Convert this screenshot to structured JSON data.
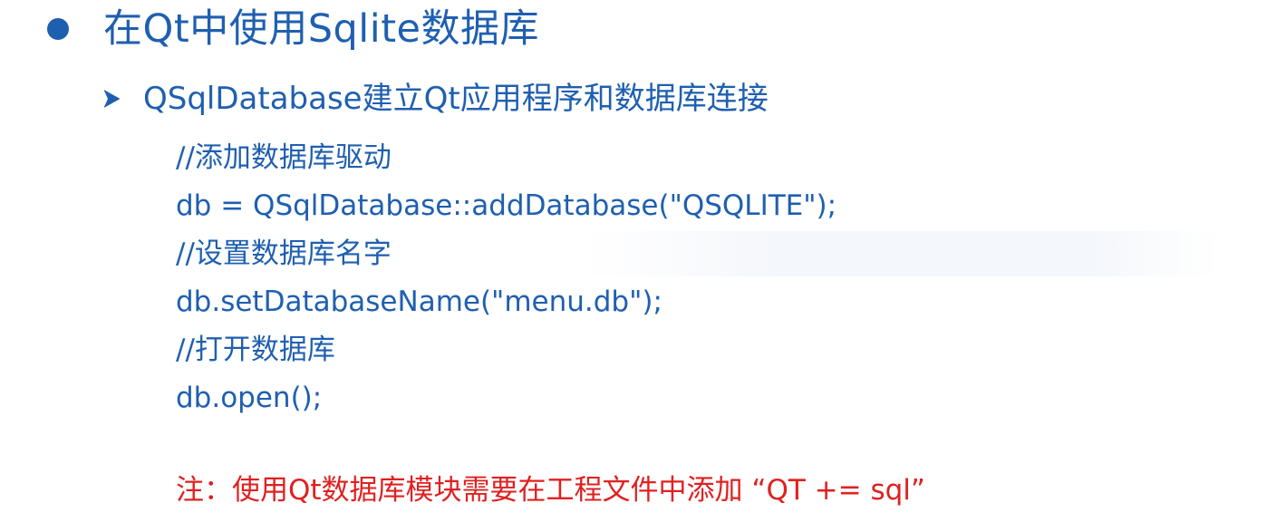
{
  "slide": {
    "title": "在Qt中使用Sqlite数据库",
    "subtitle": "QSqlDatabase建立Qt应用程序和数据库连接",
    "code_lines": [
      "//添加数据库驱动",
      "db = QSqlDatabase::addDatabase(\"QSQLITE\");",
      "//设置数据库名字",
      "db.setDatabaseName(\"menu.db\");",
      "//打开数据库",
      "db.open();"
    ],
    "note": "注：使用Qt数据库模块需要在工程文件中添加 “QT += sql”"
  },
  "colors": {
    "primary_text": "#1f5fb0",
    "note_text": "#e02020",
    "background": "#ffffff"
  },
  "icons": {
    "title_bullet": "filled-circle-bullet",
    "sub_bullet": "arrow-chevron-bullet"
  }
}
